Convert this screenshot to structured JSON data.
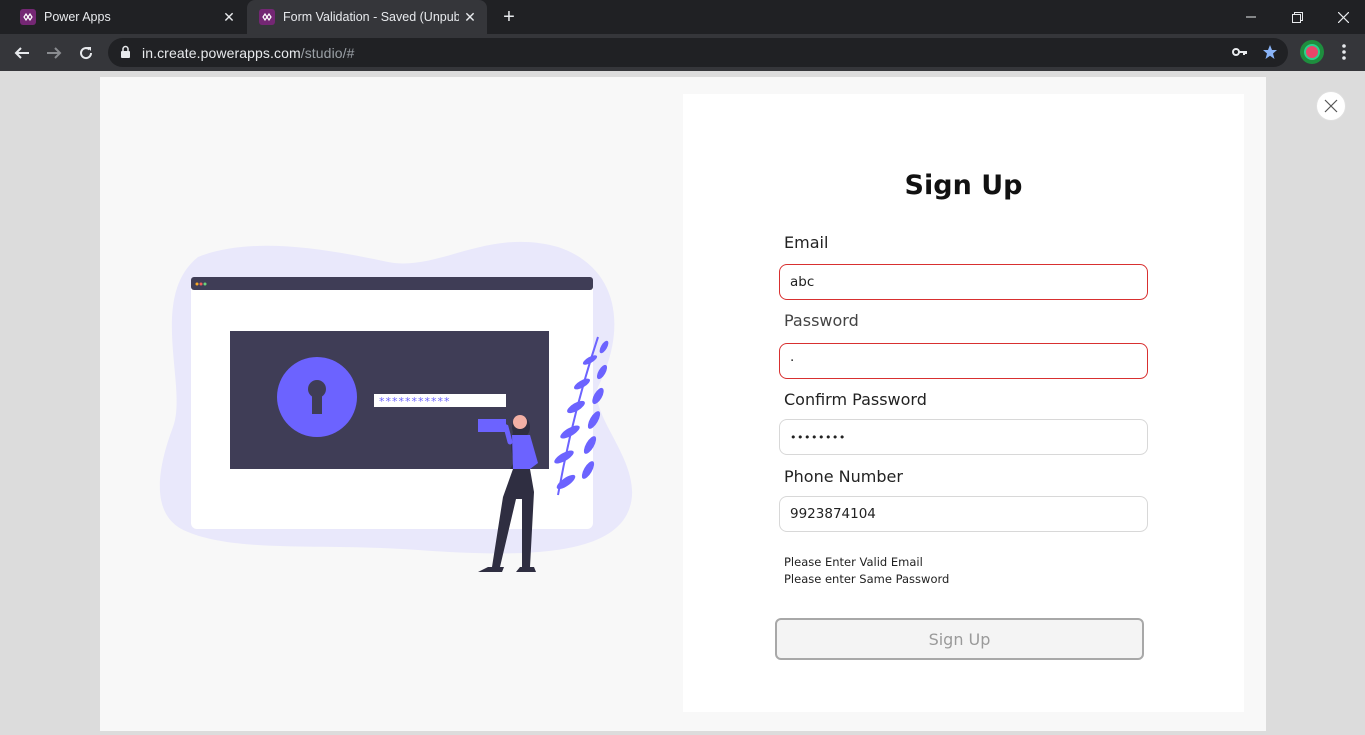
{
  "browser": {
    "tabs": [
      {
        "title": "Power Apps",
        "active": false
      },
      {
        "title": "Form Validation - Saved (Unpublished)",
        "active": true
      }
    ],
    "url_host": "in.create.powerapps.com",
    "url_path": "/studio/#"
  },
  "form": {
    "title": "Sign Up",
    "email": {
      "label": "Email",
      "value": "abc",
      "state": "invalid"
    },
    "password": {
      "label": "Password",
      "value": "·",
      "state": "invalid"
    },
    "confirm_password": {
      "label": "Confirm Password",
      "value": "••••••••"
    },
    "phone": {
      "label": "Phone Number",
      "value": "9923874104"
    },
    "errors": [
      "Please Enter Valid Email",
      "Please enter Same Password"
    ],
    "submit_label": "Sign Up"
  },
  "colors": {
    "accent": "#6c63ff",
    "invalid_border": "#d83030",
    "brand": "#742774"
  },
  "icons": {
    "tab_favicon": "powerapps-icon",
    "app_close": "close-icon",
    "illustration": "security-login-illustration"
  }
}
